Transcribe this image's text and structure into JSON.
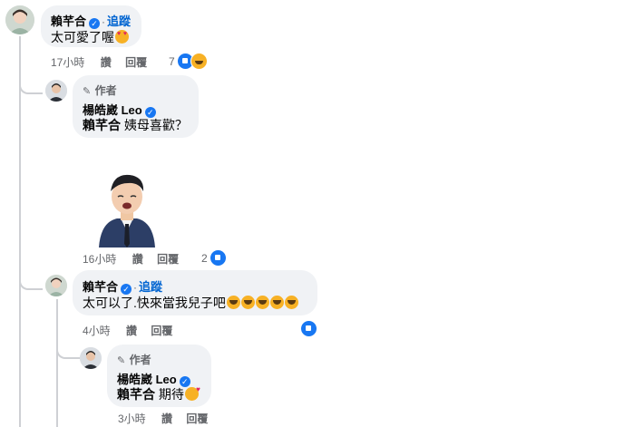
{
  "comments": [
    {
      "author": "賴芊合",
      "follow": "追蹤",
      "text": "太可愛了喔",
      "emojis": [
        "heart-eyes"
      ],
      "time": "17小時",
      "like": "讚",
      "reply": "回覆",
      "reaction_count": "7",
      "reactions": [
        "like",
        "haha"
      ]
    },
    {
      "author_tag": "作者",
      "author": "楊皓崴 Leo",
      "mention": "賴芊合",
      "text": "姨母喜歡？",
      "sticker": "cartoon-man-in-suit-sticker",
      "time": "16小時",
      "like": "讚",
      "reply": "回覆",
      "reaction_count": "2",
      "reactions": [
        "like"
      ]
    },
    {
      "author": "賴芊合",
      "follow": "追蹤",
      "text": "太可以了.快來當我兒子吧",
      "emojis": [
        "rofl",
        "rofl",
        "rofl",
        "rofl",
        "rofl"
      ],
      "time": "4小時",
      "like": "讚",
      "reply": "回覆",
      "reactions": [
        "like"
      ]
    },
    {
      "author_tag": "作者",
      "author": "楊皓崴 Leo",
      "mention": "賴芊合",
      "text": "期待",
      "emojis": [
        "smiling-face-with-hearts"
      ],
      "time": "3小時",
      "like": "讚",
      "reply": "回覆"
    }
  ],
  "colors": {
    "bubble": "#f0f2f5",
    "link": "#0064d1",
    "meta": "#65676b",
    "like": "#1877f2",
    "thread_line": "#ced0d4"
  }
}
